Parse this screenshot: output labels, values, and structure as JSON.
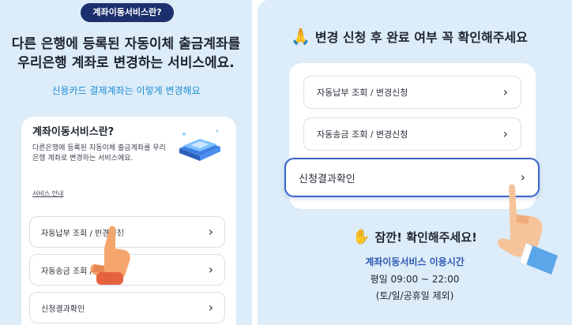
{
  "left": {
    "badge": "계좌이동서비스란?",
    "headline_line1": "다른 은행에 등록된 자동이체 출금계좌를",
    "headline_line2": "우리은행 계좌로 변경하는 서비스에요.",
    "sublink": "신용카드 결제계좌는 이렇게 변경해요",
    "card": {
      "title": "계좌이동서비스란?",
      "description": "다른은행에 등록된 자동이체 출금계좌를 우리은행 계좌로 변경하는 서비스에요.",
      "link": "서비스 안내"
    },
    "menu": [
      {
        "label": "자동납부 조회 / 변경신청"
      },
      {
        "label": "자동송금 조회 / 변경신청"
      },
      {
        "label": "신청결과확인"
      }
    ]
  },
  "right": {
    "header": "변경 신청 후 완료 여부 꼭 확인해주세요",
    "header_emoji": "🙏",
    "menu": [
      {
        "label": "자동납부 조회 / 변경신청"
      },
      {
        "label": "자동송금 조회 / 변경신청"
      },
      {
        "label": "신청결과확인"
      }
    ],
    "notice_emoji": "✋",
    "notice": "잠깐! 확인해주세요!",
    "service_title": "계좌이동서비스 이용시간",
    "service_hours": "평일 09:00 ~ 22:00",
    "service_note": "(토/일/공휴일 제외)"
  },
  "icons": {
    "chevron": "chevron-right-icon",
    "pointer": "pointing-hand-icon",
    "book": "book-icon"
  },
  "colors": {
    "panel_bg": "#dcecf8",
    "badge_bg": "#1c2f6e",
    "link_blue": "#1e8fd6",
    "highlight_border": "#3a63c9",
    "service_title": "#2f5ab5"
  }
}
